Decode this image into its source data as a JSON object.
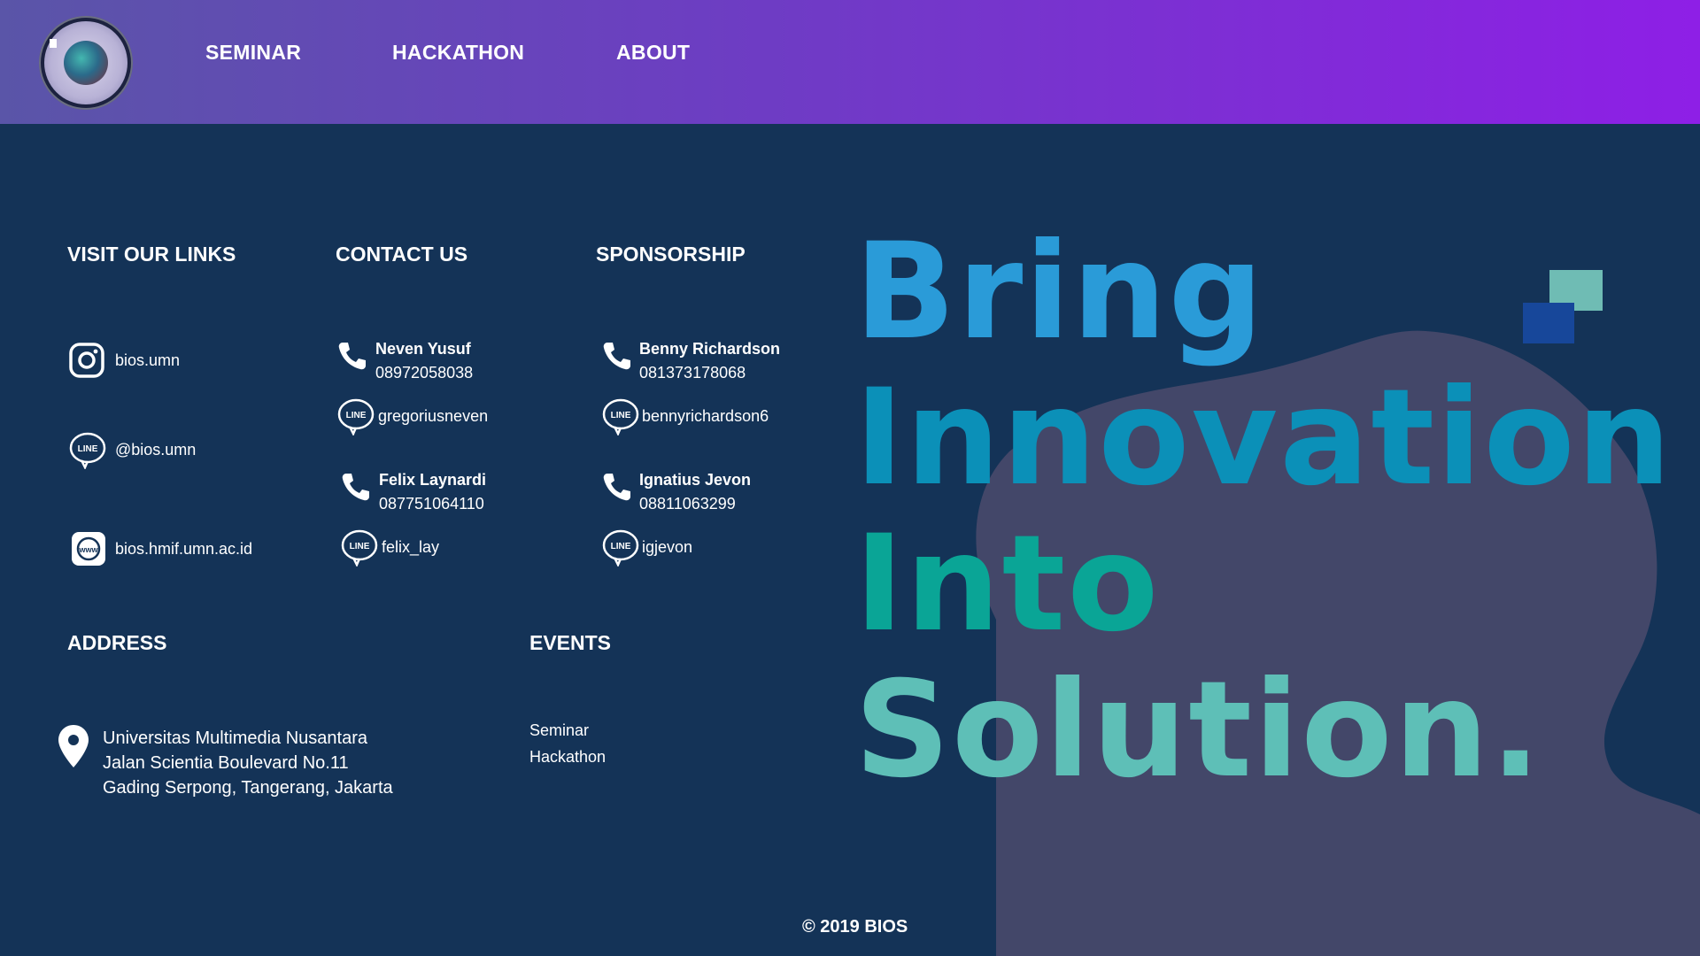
{
  "nav": {
    "items": [
      {
        "label": "SEMINAR"
      },
      {
        "label": "HACKATHON"
      },
      {
        "label": "ABOUT"
      }
    ]
  },
  "links": {
    "title": "VISIT OUR LINKS",
    "items": [
      {
        "icon": "instagram-icon",
        "label": "bios.umn"
      },
      {
        "icon": "line-icon",
        "label": "@bios.umn"
      },
      {
        "icon": "web-icon",
        "label": "bios.hmif.umn.ac.id"
      }
    ]
  },
  "contact": {
    "title": "CONTACT US",
    "people": [
      {
        "name": "Neven Yusuf",
        "phone": "08972058038",
        "line": "gregoriusneven"
      },
      {
        "name": "Felix Laynardi",
        "phone": "087751064110",
        "line": "felix_lay"
      }
    ]
  },
  "sponsorship": {
    "title": "SPONSORSHIP",
    "people": [
      {
        "name": "Benny Richardson",
        "phone": "081373178068",
        "line": "bennyrichardson6"
      },
      {
        "name": "Ignatius Jevon",
        "phone": "08811063299",
        "line": "igjevon"
      }
    ]
  },
  "address": {
    "title": "ADDRESS",
    "lines": [
      "Universitas Multimedia Nusantara",
      "Jalan Scientia Boulevard No.11",
      "Gading Serpong, Tangerang, Jakarta"
    ]
  },
  "events": {
    "title": "EVENTS",
    "items": [
      "Seminar",
      "Hackathon"
    ]
  },
  "hero": {
    "line1": "Bring",
    "line2": "Innovation",
    "line3": "Into",
    "line4": "Solution."
  },
  "footer": {
    "copyright": "© 2019 BIOS"
  },
  "colors": {
    "background": "#143357",
    "blob": "#434769",
    "line1": "#2a9bd8",
    "line2": "#0b90b8",
    "line3": "#0aa596",
    "line4": "#5ebfb7"
  }
}
